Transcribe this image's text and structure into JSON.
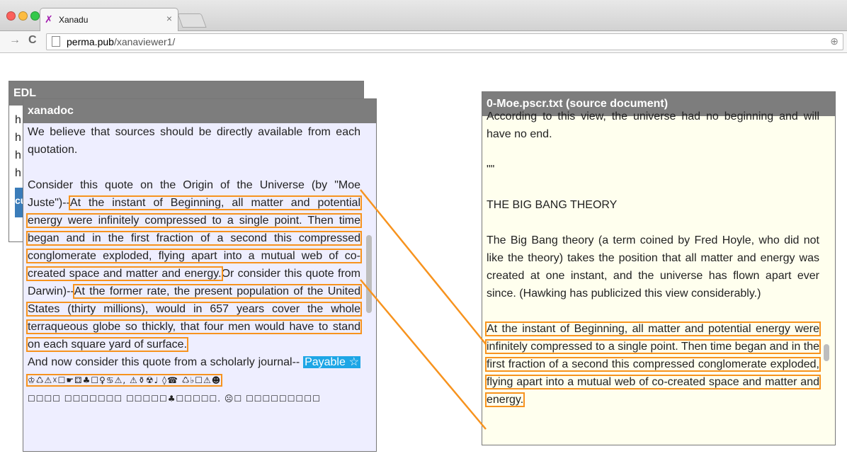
{
  "browser": {
    "tab_title": "Xanadu",
    "tab_close": "×",
    "url_host": "perma.pub",
    "url_path": "/xanaviewer1/",
    "back_glyph": "→",
    "reload_glyph": "C",
    "zoom_glyph": "⊕"
  },
  "edl": {
    "title": "EDL",
    "lines": [
      "h",
      "h",
      "h",
      "h"
    ],
    "button_label": "cu"
  },
  "xanadoc": {
    "title": "xanadoc",
    "line1": "We believe that sources should be directly available from each quotation.",
    "line2_pre": "Consider this quote on the Origin of the Universe (by \"Moe Juste\")--",
    "quote1": "At the instant of Beginning, all matter and potential energy were infinitely compressed to a single point. Then time began and in the first fraction of a second this compressed conglomerate exploded, flying apart into a mutual web of co-created space and matter and energy.",
    "line3_pre": "Or consider this quote from Darwin)--",
    "quote2": "At the former rate, the present population of the United States (thirty millions), would in 657 years cover the whole terraqueous globe so thickly, that four men would have to stand on each square yard of surface.",
    "line4": "And now consider this quote from a scholarly journal--",
    "payable": "Payable ☆",
    "glyph_line1": "♔♺⚠☓☐☛⚃♣☐♀♋⚠, ⚠⚱☢♩ ◊☎ ♺♭☐⚠☻",
    "glyph_line2": "☐☐☐☐ ☐☐☐☐☐☐☐ ☐☐☐☐☐♣☐☐☐☐☐. ☹☐ ☐☐☐☐☐☐☐☐☐"
  },
  "source": {
    "title": "0-Moe.pscr.txt (source document)",
    "line1": "According to this view, the universe had no beginning and will have no end.",
    "line2": "\"\"",
    "line3": "THE BIG BANG THEORY",
    "line4": "The Big Bang theory (a term coined by Fred Hoyle, who did not like the theory) takes the position that all matter and energy was created at one instant, and the universe has flown apart ever since. (Hawking has publicized this view considerably.)",
    "quote": "At the instant of Beginning, all matter and potential energy were infinitely compressed to a single point. Then time began and in the first fraction of a second this compressed conglomerate exploded, flying apart into a mutual web of co-created space and matter and energy."
  },
  "colors": {
    "highlight": "#f7931e",
    "xanadoc_bg": "#eeeeff",
    "source_bg": "#ffffee",
    "header_bg": "#7d7d7d",
    "payable_bg": "#1ea6e6"
  }
}
